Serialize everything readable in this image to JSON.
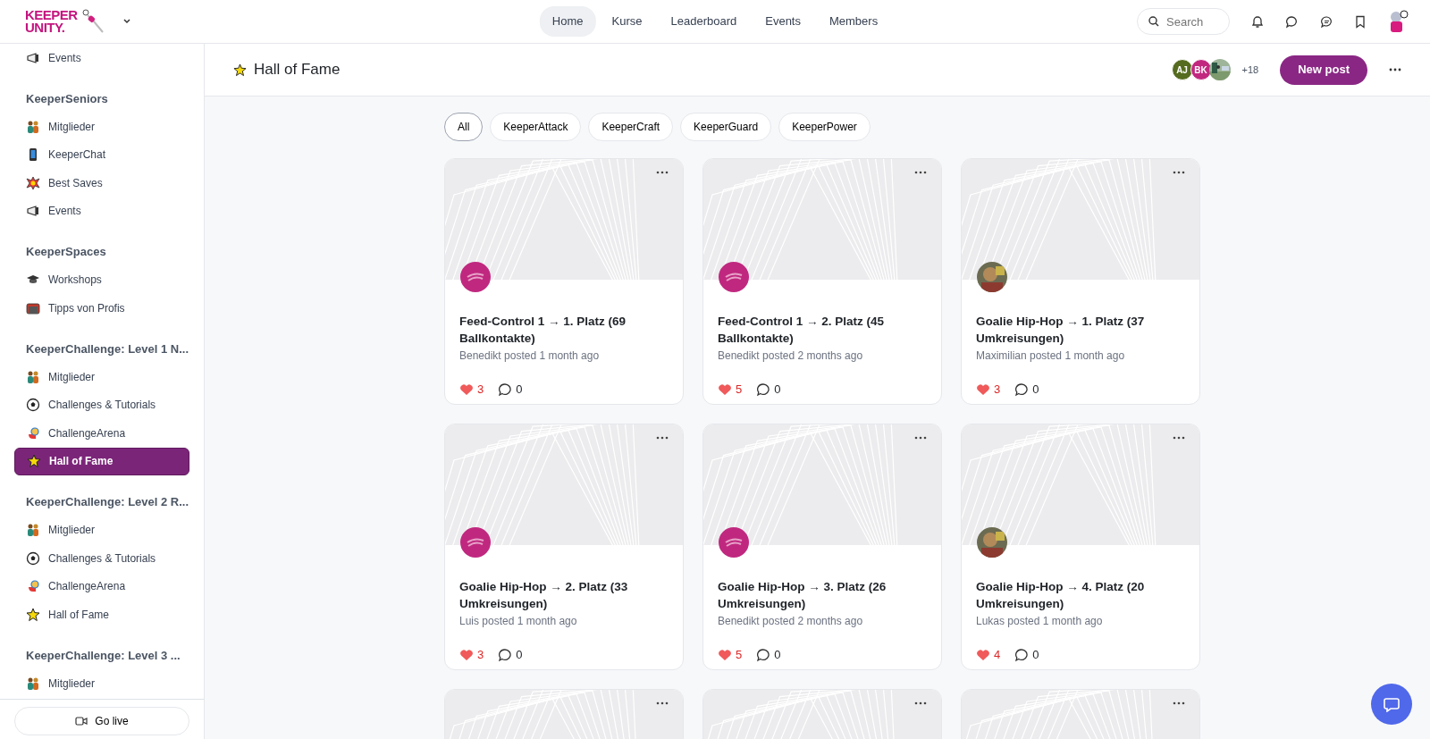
{
  "logo": {
    "line_1": "KEEPER",
    "line_2": "UNITY."
  },
  "nav": [
    {
      "label": "Home",
      "selected": true
    },
    {
      "label": "Kurse",
      "selected": false
    },
    {
      "label": "Leaderboard",
      "selected": false
    },
    {
      "label": "Events",
      "selected": false
    },
    {
      "label": "Members",
      "selected": false
    }
  ],
  "search": {
    "placeholder": "Search"
  },
  "sidebar": {
    "sections": [
      {
        "items": [
          {
            "label": "Events",
            "kind": "megaphone",
            "selected": false
          }
        ]
      },
      {
        "title": "KeeperSeniors",
        "items": [
          {
            "label": "Mitglieder",
            "kind": "people",
            "selected": false
          },
          {
            "label": "KeeperChat",
            "kind": "phone",
            "selected": false
          },
          {
            "label": "Best Saves",
            "kind": "burst",
            "selected": false
          },
          {
            "label": "Events",
            "kind": "megaphone",
            "selected": false
          }
        ]
      },
      {
        "title": "KeeperSpaces",
        "items": [
          {
            "label": "Workshops",
            "kind": "cap",
            "selected": false
          },
          {
            "label": "Tipps von Profis",
            "kind": "goal",
            "selected": false
          }
        ]
      },
      {
        "title": "KeeperChallenge: Level 1 N...",
        "items": [
          {
            "label": "Mitglieder",
            "kind": "people",
            "selected": false
          },
          {
            "label": "Challenges & Tutorials",
            "kind": "ball",
            "selected": false
          },
          {
            "label": "ChallengeArena",
            "kind": "glove",
            "selected": false
          },
          {
            "label": "Hall of Fame",
            "kind": "star",
            "selected": true
          }
        ]
      },
      {
        "title": "KeeperChallenge: Level 2 R...",
        "items": [
          {
            "label": "Mitglieder",
            "kind": "people",
            "selected": false
          },
          {
            "label": "Challenges & Tutorials",
            "kind": "ball",
            "selected": false
          },
          {
            "label": "ChallengeArena",
            "kind": "glove",
            "selected": false
          },
          {
            "label": "Hall of Fame",
            "kind": "star",
            "selected": false
          }
        ]
      },
      {
        "title": "KeeperChallenge: Level 3 ...",
        "items": [
          {
            "label": "Mitglieder",
            "kind": "people",
            "selected": false
          }
        ]
      }
    ],
    "go_live": "Go live"
  },
  "page": {
    "title": "Hall of Fame",
    "members": [
      {
        "kind": "initials",
        "initials": "AJ",
        "color": "#556b1f"
      },
      {
        "kind": "initials",
        "initials": "BK",
        "color": "#c2277f"
      },
      {
        "kind": "picture"
      }
    ],
    "member_count": "+18",
    "new_post": "New post"
  },
  "filters": [
    {
      "label": "All",
      "selected": true
    },
    {
      "label": "KeeperAttack",
      "selected": false
    },
    {
      "label": "KeeperCraft",
      "selected": false
    },
    {
      "label": "KeeperGuard",
      "selected": false
    },
    {
      "label": "KeeperPower",
      "selected": false
    }
  ],
  "posts": [
    {
      "title": "Feed-Control 1 → 1. Platz (69 Ballkontakte)",
      "meta": "Benedikt posted 1 month ago",
      "likes": "3",
      "comments": "0",
      "avatar": {
        "kind": "logo"
      }
    },
    {
      "title": "Feed-Control 1 → 2. Platz (45 Ballkontakte)",
      "meta": "Benedikt posted 2 months ago",
      "likes": "5",
      "comments": "0",
      "avatar": {
        "kind": "logo"
      }
    },
    {
      "title": "Goalie Hip-Hop → 1. Platz (37 Umkreisungen)",
      "meta": "Maximilian posted 1 month ago",
      "likes": "3",
      "comments": "0",
      "avatar": {
        "kind": "picture"
      }
    },
    {
      "title": "Goalie Hip-Hop → 2. Platz (33 Umkreisungen)",
      "meta": "Luis posted 1 month ago",
      "likes": "3",
      "comments": "0",
      "avatar": {
        "kind": "logo"
      }
    },
    {
      "title": "Goalie Hip-Hop → 3. Platz (26 Umkreisungen)",
      "meta": "Benedikt posted 2 months ago",
      "likes": "5",
      "comments": "0",
      "avatar": {
        "kind": "logo"
      }
    },
    {
      "title": "Goalie Hip-Hop → 4. Platz (20 Umkreisungen)",
      "meta": "Lukas posted 1 month ago",
      "likes": "4",
      "comments": "0",
      "avatar": {
        "kind": "picture"
      }
    }
  ],
  "partial_posts": [
    {
      "kind": "cover"
    },
    {
      "kind": "cover"
    },
    {
      "kind": "cover"
    }
  ]
}
